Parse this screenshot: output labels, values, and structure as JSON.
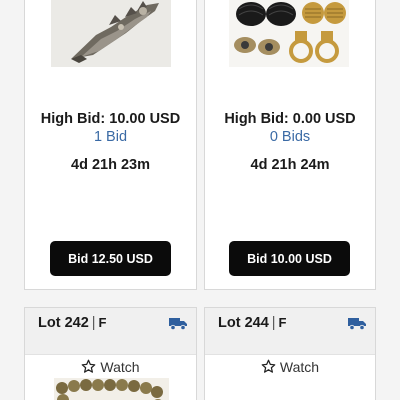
{
  "lots_top": [
    {
      "image_icon": "metal-claw-ring-image",
      "high_bid_label": "High Bid: 10.00 USD",
      "bid_count": "1 Bid",
      "time_left": "4d 21h 23m",
      "bid_button": "Bid 12.50 USD"
    },
    {
      "image_icon": "black-gold-earrings-image",
      "high_bid_label": "High Bid: 0.00 USD",
      "bid_count": "0 Bids",
      "time_left": "4d 21h 24m",
      "bid_button": "Bid 10.00 USD"
    }
  ],
  "lots_bottom": [
    {
      "lot_label": "Lot 242",
      "separator": "|",
      "category": "F",
      "shipping_icon": "truck-icon",
      "watch_icon": "star-icon",
      "watch_label": "Watch",
      "image_icon": "bead-bracelet-image"
    },
    {
      "lot_label": "Lot 244",
      "separator": "|",
      "category": "F",
      "shipping_icon": "truck-icon",
      "watch_icon": "star-icon",
      "watch_label": "Watch"
    }
  ],
  "colors": {
    "link_blue": "#3a6aa5",
    "truck_blue": "#2f5f9e",
    "button_black": "#0b0b0b",
    "header_gray": "#f0f0f0"
  }
}
